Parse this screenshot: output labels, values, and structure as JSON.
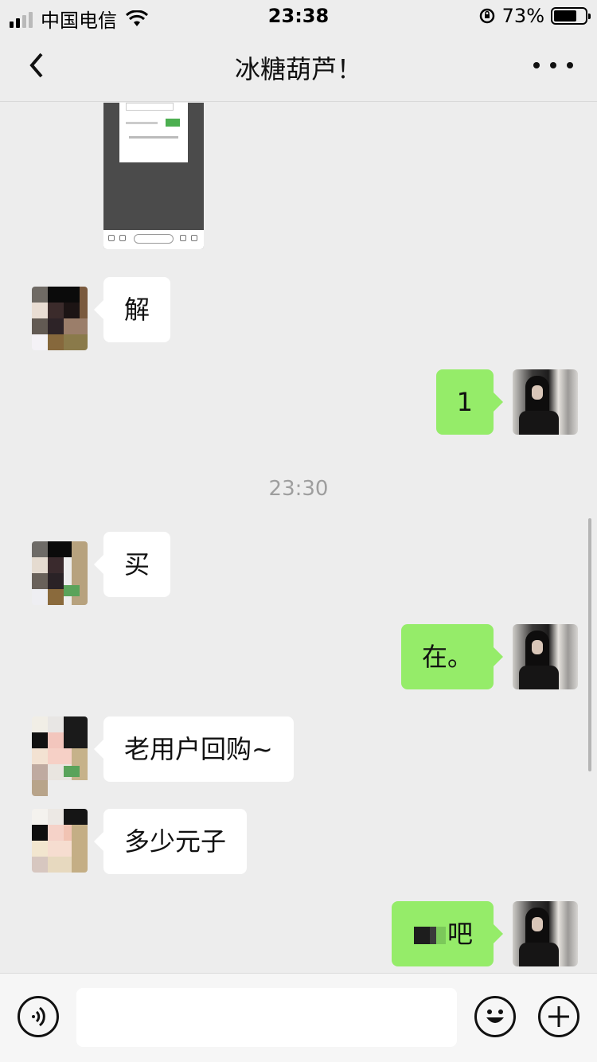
{
  "status_bar": {
    "carrier": "中国电信",
    "time": "23:38",
    "battery_percent": "73%",
    "battery_level": 0.73
  },
  "nav": {
    "title": "冰糖葫芦！"
  },
  "chat": {
    "timestamp": "23:30",
    "messages": [
      {
        "side": "left",
        "type": "image"
      },
      {
        "side": "left",
        "text": "解"
      },
      {
        "side": "right",
        "text": "1"
      },
      {
        "side": "left",
        "text": "买"
      },
      {
        "side": "right",
        "text": "在。"
      },
      {
        "side": "left",
        "text": "老用户回购~"
      },
      {
        "side": "left",
        "text": "多少元子"
      },
      {
        "side": "right",
        "text": "吧"
      }
    ]
  },
  "input": {
    "placeholder": ""
  },
  "icons": {
    "back": "back-icon",
    "more": "more-icon",
    "voice": "voice-icon",
    "emoji": "emoji-icon",
    "plus": "plus-icon"
  }
}
